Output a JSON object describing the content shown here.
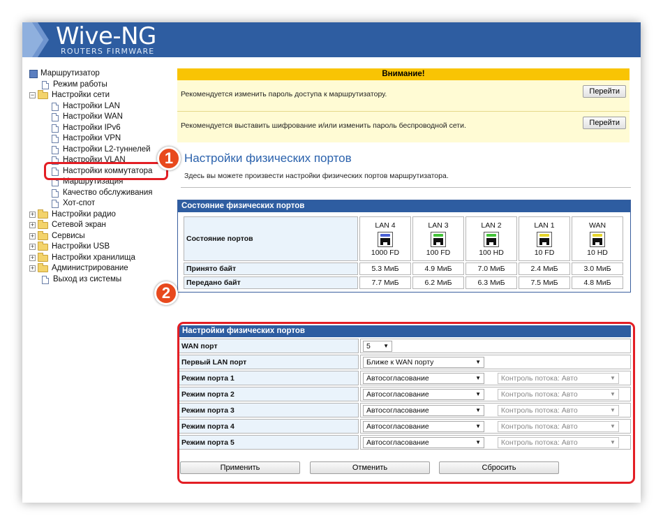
{
  "header": {
    "title": "Wive-NG",
    "subtitle": "ROUTERS FIRMWARE",
    "brand_color": "#2e5da1"
  },
  "tree": {
    "root": "Маршрутизатор",
    "items": [
      {
        "label": "Режим работы",
        "level": 1,
        "type": "doc"
      },
      {
        "label": "Настройки сети",
        "level": 0,
        "type": "folder",
        "expanded": true
      },
      {
        "label": "Настройки LAN",
        "level": 2,
        "type": "doc"
      },
      {
        "label": "Настройки WAN",
        "level": 2,
        "type": "doc"
      },
      {
        "label": "Настройки IPv6",
        "level": 2,
        "type": "doc"
      },
      {
        "label": "Настройки VPN",
        "level": 2,
        "type": "doc"
      },
      {
        "label": "Настройки L2-туннелей",
        "level": 2,
        "type": "doc"
      },
      {
        "label": "Настройки VLAN",
        "level": 2,
        "type": "doc"
      },
      {
        "label": "Настройки коммутатора",
        "level": 2,
        "type": "doc",
        "highlighted": true
      },
      {
        "label": "Маршрутизация",
        "level": 2,
        "type": "doc"
      },
      {
        "label": "Качество обслуживания",
        "level": 2,
        "type": "doc"
      },
      {
        "label": "Хот-спот",
        "level": 2,
        "type": "doc"
      },
      {
        "label": "Настройки радио",
        "level": 0,
        "type": "folder"
      },
      {
        "label": "Сетевой экран",
        "level": 0,
        "type": "folder"
      },
      {
        "label": "Сервисы",
        "level": 0,
        "type": "folder"
      },
      {
        "label": "Настройки USB",
        "level": 0,
        "type": "folder"
      },
      {
        "label": "Настройки хранилища",
        "level": 0,
        "type": "folder"
      },
      {
        "label": "Администрирование",
        "level": 0,
        "type": "folder"
      },
      {
        "label": "Выход из системы",
        "level": 1,
        "type": "doc"
      }
    ]
  },
  "annotations": {
    "step1": "1",
    "step2": "2",
    "highlight_color": "#e31e24",
    "badge_color": "#e8491d"
  },
  "warning": {
    "title": "Внимание!",
    "rows": [
      {
        "text": "Рекомендуется изменить пароль доступа к маршрутизатору.",
        "button": "Перейти"
      },
      {
        "text": "Рекомендуется выставить шифрование и/или изменить пароль беспроводной сети.",
        "button": "Перейти"
      }
    ]
  },
  "page": {
    "title": "Настройки физических портов",
    "description": "Здесь вы можете произвести настройки физических портов маршрутизатора."
  },
  "status": {
    "title": "Состояние физических портов",
    "row_state": "Состояние портов",
    "row_rx": "Принято байт",
    "row_tx": "Передано байт",
    "ports": [
      {
        "name": "LAN 4",
        "mode": "1000 FD",
        "rx": "5.3 МиБ",
        "tx": "7.7 МиБ",
        "led": "#4d63d6"
      },
      {
        "name": "LAN 3",
        "mode": "100 FD",
        "rx": "4.9 МиБ",
        "tx": "6.2 МиБ",
        "led": "#46c43a"
      },
      {
        "name": "LAN 2",
        "mode": "100 HD",
        "rx": "7.0 МиБ",
        "tx": "6.3 МиБ",
        "led": "#46c43a"
      },
      {
        "name": "LAN 1",
        "mode": "10 FD",
        "rx": "2.4 МиБ",
        "tx": "7.5 МиБ",
        "led": "#e6d62c"
      },
      {
        "name": "WAN",
        "mode": "10 HD",
        "rx": "3.0 МиБ",
        "tx": "4.8 МиБ",
        "led": "#e6d62c"
      }
    ]
  },
  "config": {
    "title": "Настройки физических портов",
    "wan_port": {
      "label": "WAN порт",
      "value": "5"
    },
    "first_lan": {
      "label": "Первый LAN порт",
      "value": "Ближе к WAN порту"
    },
    "port_modes": [
      {
        "label": "Режим порта 1",
        "mode": "Автосогласование",
        "flow": "Контроль потока: Авто"
      },
      {
        "label": "Режим порта 2",
        "mode": "Автосогласование",
        "flow": "Контроль потока: Авто"
      },
      {
        "label": "Режим порта 3",
        "mode": "Автосогласование",
        "flow": "Контроль потока: Авто"
      },
      {
        "label": "Режим порта 4",
        "mode": "Автосогласование",
        "flow": "Контроль потока: Авто"
      },
      {
        "label": "Режим порта 5",
        "mode": "Автосогласование",
        "flow": "Контроль потока: Авто"
      }
    ],
    "buttons": {
      "apply": "Применить",
      "cancel": "Отменить",
      "reset": "Сбросить"
    }
  }
}
